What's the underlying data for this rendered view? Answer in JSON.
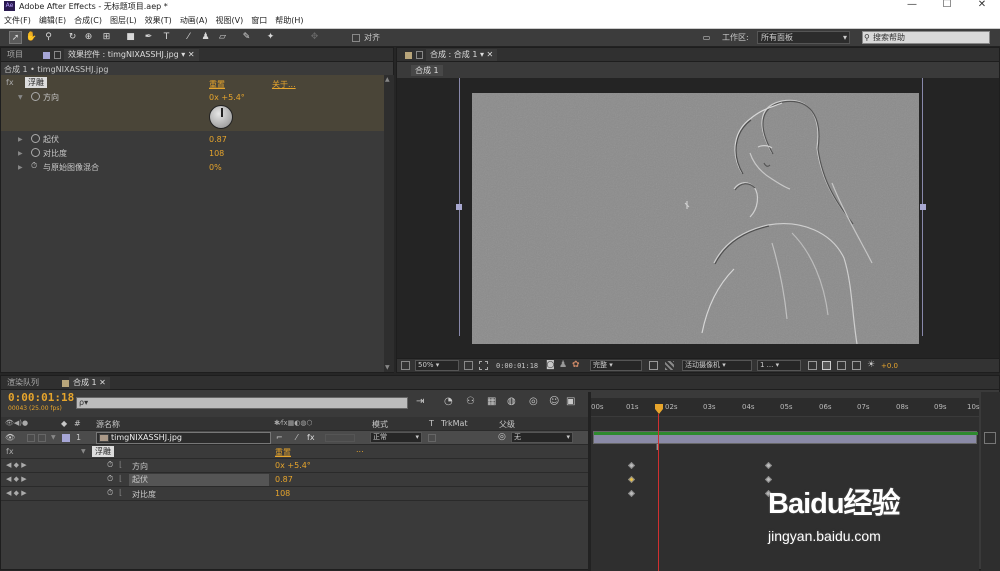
{
  "window": {
    "title": "Adobe After Effects - 无标题项目.aep *",
    "app_icon": "Ae",
    "min": "—",
    "max": "☐",
    "close": "✕"
  },
  "menu": [
    "文件(F)",
    "编辑(E)",
    "合成(C)",
    "图层(L)",
    "效果(T)",
    "动画(A)",
    "视图(V)",
    "窗口",
    "帮助(H)"
  ],
  "toolbar": {
    "snap_label": "对齐",
    "workspace_label": "工作区:",
    "workspace_value": "所有面板",
    "search_placeholder": "搜索帮助"
  },
  "left_panel": {
    "tab_project": "项目",
    "tab_effect_controls": "效果控件 : timgNIXASSHJ.jpg",
    "breadcrumb": "合成 1 • timgNIXASSHJ.jpg",
    "effect_name": "浮雕",
    "reset": "重置",
    "about": "关于...",
    "properties": [
      {
        "name": "方向",
        "value": "0x +5.4°"
      },
      {
        "name": "起伏",
        "value": "0.87"
      },
      {
        "name": "对比度",
        "value": "108"
      },
      {
        "name": "与原始图像混合",
        "value": "0%"
      }
    ]
  },
  "comp_panel": {
    "tab_label": "合成 : 合成 1",
    "sub_tab": "合成 1",
    "zoom": "50%",
    "timecode": "0:00:01:18",
    "resolution": "完整",
    "camera": "活动摄像机",
    "views": "1 ...",
    "exposure": "+0.0"
  },
  "timeline": {
    "tab_render": "渲染队列",
    "tab_comp": "合成 1",
    "current_time": "0:00:01:18",
    "frame_info": "00043 (25.00 fps)",
    "search_placeholder": "ρ▾",
    "col_source": "源名称",
    "col_mode": "模式",
    "col_t": "T",
    "col_trkmat": "TrkMat",
    "col_parent": "父级",
    "col_num": "#",
    "layer": {
      "index": "1",
      "name": "timgNIXASSHJ.jpg",
      "mode": "正常",
      "parent": "无"
    },
    "effect_name": "浮雕",
    "reset": "重置",
    "dots": "...",
    "fx": "fx",
    "properties": [
      {
        "name": "方向",
        "value": "0x +5.4°"
      },
      {
        "name": "起伏",
        "value": "0.87"
      },
      {
        "name": "对比度",
        "value": "108"
      }
    ],
    "ruler": [
      "00s",
      "01s",
      "02s",
      "03s",
      "04s",
      "05s",
      "06s",
      "07s",
      "08s",
      "09s",
      "10s"
    ]
  },
  "watermark": {
    "brand": "Baidu经验",
    "url": "jingyan.baidu.com"
  },
  "colors": {
    "accent": "#e7a52c",
    "layer_bar": "#8a8aa6",
    "playhead": "#d03030"
  }
}
